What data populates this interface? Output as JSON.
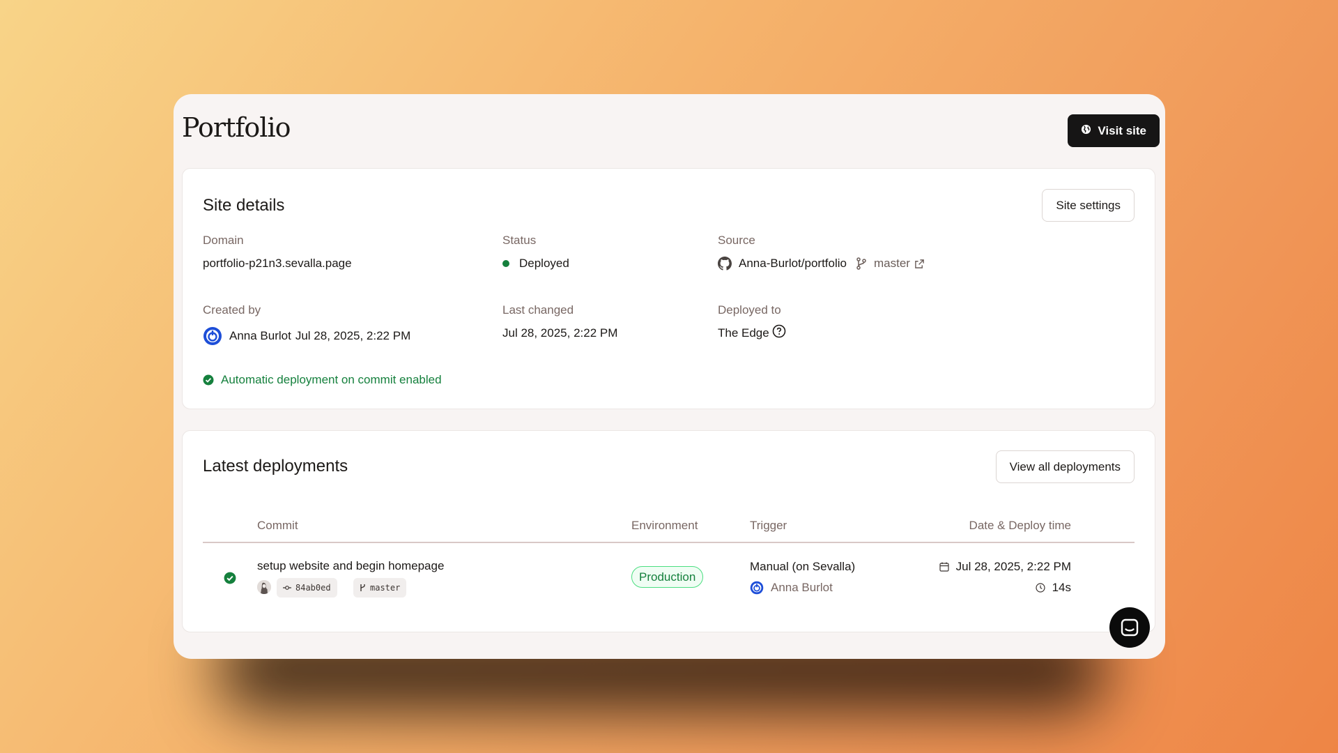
{
  "page": {
    "title": "Portfolio",
    "visit_site_label": "Visit site"
  },
  "site_details": {
    "heading": "Site details",
    "settings_label": "Site settings",
    "domain": {
      "label": "Domain",
      "value": "portfolio-p21n3.sevalla.page"
    },
    "status": {
      "label": "Status",
      "value": "Deployed",
      "color": "#15803d"
    },
    "source": {
      "label": "Source",
      "repo": "Anna-Burlot/portfolio",
      "branch": "master"
    },
    "created_by": {
      "label": "Created by",
      "user": "Anna Burlot",
      "date": "Jul 28, 2025, 2:22 PM"
    },
    "last_changed": {
      "label": "Last changed",
      "value": "Jul 28, 2025, 2:22 PM"
    },
    "deployed_to": {
      "label": "Deployed to",
      "value": "The Edge"
    },
    "auto_deploy_note": "Automatic deployment on commit enabled"
  },
  "deployments": {
    "heading": "Latest deployments",
    "view_all_label": "View all deployments",
    "columns": [
      "Commit",
      "Environment",
      "Trigger",
      "Date & Deploy time"
    ],
    "rows": [
      {
        "status_icon": "check-circle-icon",
        "commit_message": "setup website and begin homepage",
        "commit_hash": "84ab0ed",
        "branch": "master",
        "environment": "Production",
        "trigger": "Manual (on Sevalla)",
        "trigger_user": "Anna Burlot",
        "date": "Jul 28, 2025, 2:22 PM",
        "duration": "14s"
      }
    ]
  },
  "colors": {
    "accent_green": "#15803d",
    "avatar_blue": "#1d4ed8",
    "dark_button": "#161515"
  }
}
